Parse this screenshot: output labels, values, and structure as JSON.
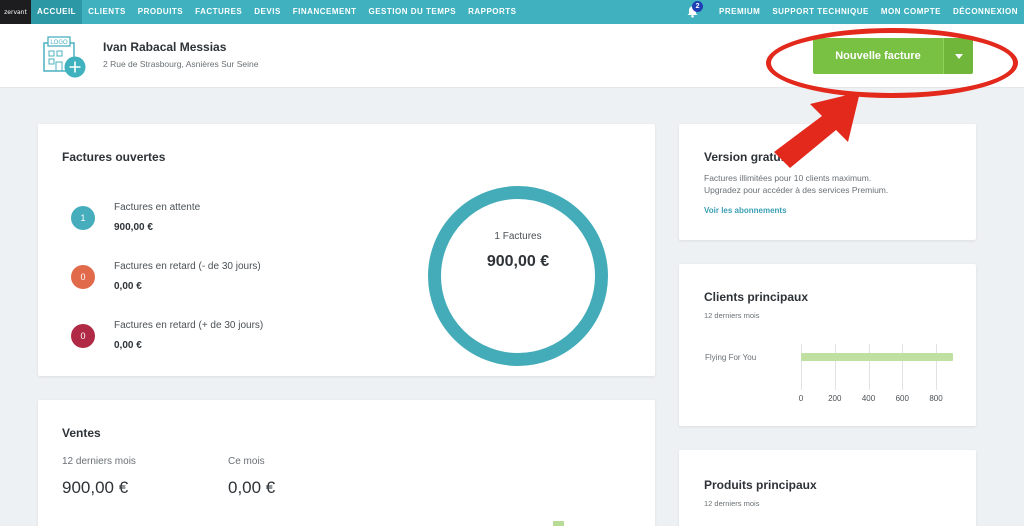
{
  "nav": {
    "logo": "zervant",
    "items": [
      "ACCUEIL",
      "CLIENTS",
      "PRODUITS",
      "FACTURES",
      "DEVIS",
      "FINANCEMENT",
      "GESTION DU TEMPS",
      "RAPPORTS"
    ],
    "right_items": [
      "PREMIUM",
      "SUPPORT TECHNIQUE",
      "MON COMPTE",
      "DÉCONNEXION"
    ],
    "notification_count": "2"
  },
  "header": {
    "logo_placeholder": "LOGO",
    "company_name": "Ivan Rabacal Messias",
    "address": "2 Rue de Strasbourg, Asnières Sur Seine",
    "new_invoice_label": "Nouvelle facture"
  },
  "open_invoices": {
    "title": "Factures ouvertes",
    "rows": [
      {
        "count": "1",
        "label": "Factures en attente",
        "amount": "900,00 €",
        "color": "#45adbb"
      },
      {
        "count": "0",
        "label": "Factures en retard (- de 30 jours)",
        "amount": "0,00 €",
        "color": "#e06a4a"
      },
      {
        "count": "0",
        "label": "Factures en retard (+ de 30 jours)",
        "amount": "0,00 €",
        "color": "#b02a45"
      }
    ],
    "donut_label": "1 Factures",
    "donut_value": "900,00 €"
  },
  "free_version": {
    "title": "Version gratuite",
    "text_line1": "Factures illimitées pour 10 clients maximum.",
    "text_line2": "Upgradez pour accéder à des services Premium.",
    "link": "Voir les abonnements"
  },
  "top_clients": {
    "title": "Clients principaux",
    "period": "12 derniers mois"
  },
  "top_products": {
    "title": "Produits principaux",
    "period": "12 derniers mois"
  },
  "sales": {
    "title": "Ventes",
    "period1_label": "12 derniers mois",
    "period1_value": "900,00 €",
    "period2_label": "Ce mois",
    "period2_value": "0,00 €"
  },
  "chart_data": {
    "type": "bar",
    "orientation": "horizontal",
    "categories": [
      "Flying For You"
    ],
    "values": [
      900
    ],
    "xlim": [
      0,
      900
    ],
    "xticks": [
      "0",
      "200",
      "400",
      "600",
      "800"
    ],
    "grid": true
  },
  "colors": {
    "nav_bg": "#3fb1bf",
    "accent_green": "#79c142",
    "donut": "#44acb9",
    "annotation_red": "#e3281c"
  }
}
